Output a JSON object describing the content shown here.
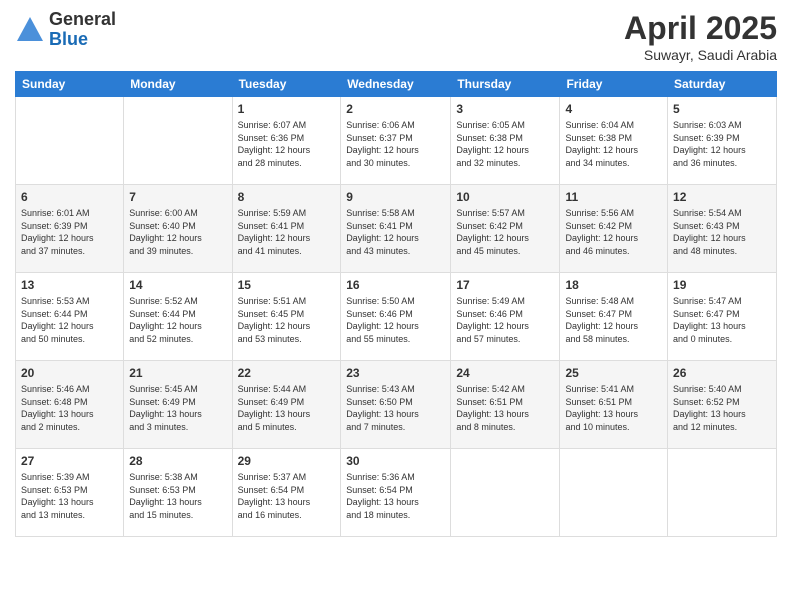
{
  "header": {
    "logo_general": "General",
    "logo_blue": "Blue",
    "month_title": "April 2025",
    "subtitle": "Suwayr, Saudi Arabia"
  },
  "days_of_week": [
    "Sunday",
    "Monday",
    "Tuesday",
    "Wednesday",
    "Thursday",
    "Friday",
    "Saturday"
  ],
  "weeks": [
    [
      {
        "day": "",
        "info": ""
      },
      {
        "day": "",
        "info": ""
      },
      {
        "day": "1",
        "info": "Sunrise: 6:07 AM\nSunset: 6:36 PM\nDaylight: 12 hours\nand 28 minutes."
      },
      {
        "day": "2",
        "info": "Sunrise: 6:06 AM\nSunset: 6:37 PM\nDaylight: 12 hours\nand 30 minutes."
      },
      {
        "day": "3",
        "info": "Sunrise: 6:05 AM\nSunset: 6:38 PM\nDaylight: 12 hours\nand 32 minutes."
      },
      {
        "day": "4",
        "info": "Sunrise: 6:04 AM\nSunset: 6:38 PM\nDaylight: 12 hours\nand 34 minutes."
      },
      {
        "day": "5",
        "info": "Sunrise: 6:03 AM\nSunset: 6:39 PM\nDaylight: 12 hours\nand 36 minutes."
      }
    ],
    [
      {
        "day": "6",
        "info": "Sunrise: 6:01 AM\nSunset: 6:39 PM\nDaylight: 12 hours\nand 37 minutes."
      },
      {
        "day": "7",
        "info": "Sunrise: 6:00 AM\nSunset: 6:40 PM\nDaylight: 12 hours\nand 39 minutes."
      },
      {
        "day": "8",
        "info": "Sunrise: 5:59 AM\nSunset: 6:41 PM\nDaylight: 12 hours\nand 41 minutes."
      },
      {
        "day": "9",
        "info": "Sunrise: 5:58 AM\nSunset: 6:41 PM\nDaylight: 12 hours\nand 43 minutes."
      },
      {
        "day": "10",
        "info": "Sunrise: 5:57 AM\nSunset: 6:42 PM\nDaylight: 12 hours\nand 45 minutes."
      },
      {
        "day": "11",
        "info": "Sunrise: 5:56 AM\nSunset: 6:42 PM\nDaylight: 12 hours\nand 46 minutes."
      },
      {
        "day": "12",
        "info": "Sunrise: 5:54 AM\nSunset: 6:43 PM\nDaylight: 12 hours\nand 48 minutes."
      }
    ],
    [
      {
        "day": "13",
        "info": "Sunrise: 5:53 AM\nSunset: 6:44 PM\nDaylight: 12 hours\nand 50 minutes."
      },
      {
        "day": "14",
        "info": "Sunrise: 5:52 AM\nSunset: 6:44 PM\nDaylight: 12 hours\nand 52 minutes."
      },
      {
        "day": "15",
        "info": "Sunrise: 5:51 AM\nSunset: 6:45 PM\nDaylight: 12 hours\nand 53 minutes."
      },
      {
        "day": "16",
        "info": "Sunrise: 5:50 AM\nSunset: 6:46 PM\nDaylight: 12 hours\nand 55 minutes."
      },
      {
        "day": "17",
        "info": "Sunrise: 5:49 AM\nSunset: 6:46 PM\nDaylight: 12 hours\nand 57 minutes."
      },
      {
        "day": "18",
        "info": "Sunrise: 5:48 AM\nSunset: 6:47 PM\nDaylight: 12 hours\nand 58 minutes."
      },
      {
        "day": "19",
        "info": "Sunrise: 5:47 AM\nSunset: 6:47 PM\nDaylight: 13 hours\nand 0 minutes."
      }
    ],
    [
      {
        "day": "20",
        "info": "Sunrise: 5:46 AM\nSunset: 6:48 PM\nDaylight: 13 hours\nand 2 minutes."
      },
      {
        "day": "21",
        "info": "Sunrise: 5:45 AM\nSunset: 6:49 PM\nDaylight: 13 hours\nand 3 minutes."
      },
      {
        "day": "22",
        "info": "Sunrise: 5:44 AM\nSunset: 6:49 PM\nDaylight: 13 hours\nand 5 minutes."
      },
      {
        "day": "23",
        "info": "Sunrise: 5:43 AM\nSunset: 6:50 PM\nDaylight: 13 hours\nand 7 minutes."
      },
      {
        "day": "24",
        "info": "Sunrise: 5:42 AM\nSunset: 6:51 PM\nDaylight: 13 hours\nand 8 minutes."
      },
      {
        "day": "25",
        "info": "Sunrise: 5:41 AM\nSunset: 6:51 PM\nDaylight: 13 hours\nand 10 minutes."
      },
      {
        "day": "26",
        "info": "Sunrise: 5:40 AM\nSunset: 6:52 PM\nDaylight: 13 hours\nand 12 minutes."
      }
    ],
    [
      {
        "day": "27",
        "info": "Sunrise: 5:39 AM\nSunset: 6:53 PM\nDaylight: 13 hours\nand 13 minutes."
      },
      {
        "day": "28",
        "info": "Sunrise: 5:38 AM\nSunset: 6:53 PM\nDaylight: 13 hours\nand 15 minutes."
      },
      {
        "day": "29",
        "info": "Sunrise: 5:37 AM\nSunset: 6:54 PM\nDaylight: 13 hours\nand 16 minutes."
      },
      {
        "day": "30",
        "info": "Sunrise: 5:36 AM\nSunset: 6:54 PM\nDaylight: 13 hours\nand 18 minutes."
      },
      {
        "day": "",
        "info": ""
      },
      {
        "day": "",
        "info": ""
      },
      {
        "day": "",
        "info": ""
      }
    ]
  ]
}
